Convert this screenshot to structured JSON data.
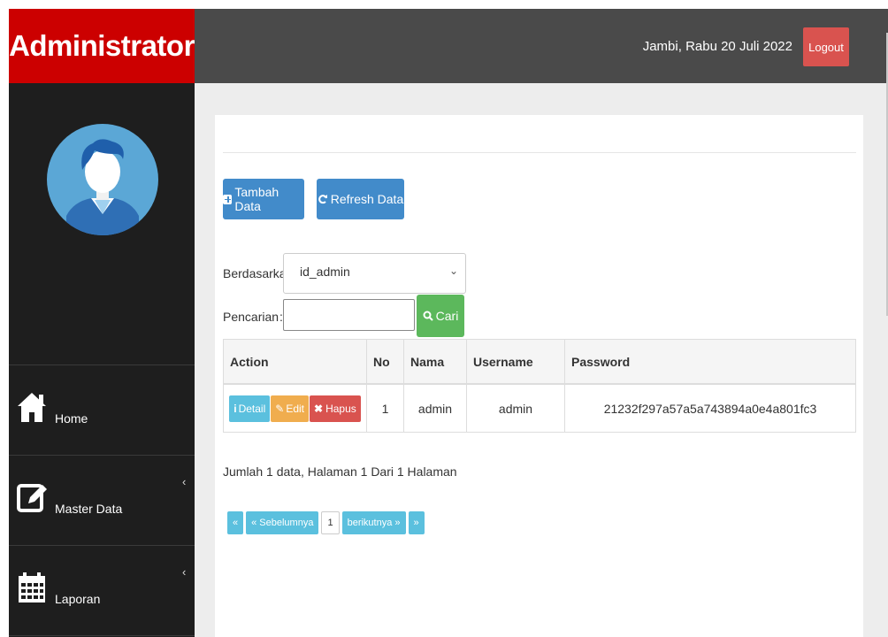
{
  "brand": {
    "title": "Administrator",
    "color": "#cc0000"
  },
  "topbar": {
    "date_text": "Jambi, Rabu 20 Juli 2022",
    "logout_label": "Logout"
  },
  "sidebar": {
    "items": [
      {
        "label": "Home",
        "icon": "home-icon"
      },
      {
        "label": "Master Data",
        "icon": "edit-icon",
        "chevron": "‹"
      },
      {
        "label": "Laporan",
        "icon": "calendar-icon",
        "chevron": "‹"
      }
    ]
  },
  "toolbar": {
    "add_label": "Tambah Data",
    "refresh_label": "Refresh Data"
  },
  "filter": {
    "by_label": "Berdasarkan:",
    "selected": "id_admin",
    "search_label": "Pencarian",
    "search_sep": ":",
    "search_value": "",
    "search_button": "Cari"
  },
  "table": {
    "headers": [
      "Action",
      "No",
      "Nama",
      "Username",
      "Password"
    ],
    "rows": [
      {
        "no": "1",
        "nama": "admin",
        "username": "admin",
        "password": "21232f297a57a5a743894a0e4a801fc3"
      }
    ],
    "actions": {
      "detail": "Detail",
      "edit": "Edit",
      "hapus": "Hapus"
    }
  },
  "summary": "Jumlah 1 data, Halaman 1 Dari 1 Halaman",
  "pagination": {
    "first": "«",
    "prev": "« Sebelumnya",
    "current": "1",
    "next": "berikutnya »",
    "last": "»"
  }
}
